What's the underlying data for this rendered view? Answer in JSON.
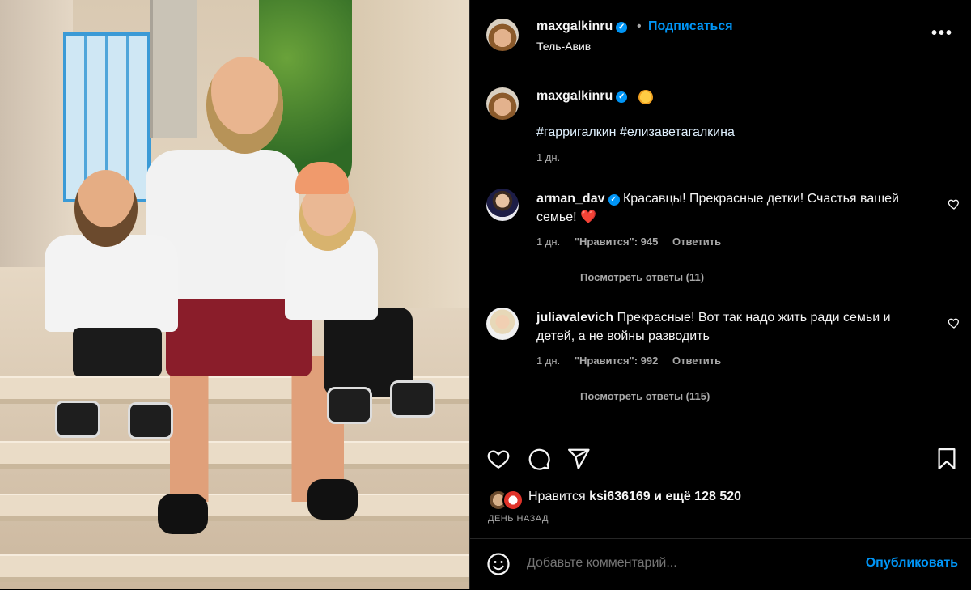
{
  "post": {
    "author": "maxgalkinru",
    "follow_label": "Подписаться",
    "location": "Тель-Авив",
    "more_label": "•••",
    "verified_mark": "✓"
  },
  "caption": {
    "author": "maxgalkinru",
    "hashtags": "#гарригалкин #елизаветагалкина",
    "time": "1 дн."
  },
  "comments": [
    {
      "author": "arman_dav",
      "verified": true,
      "text_line1": "Красавцы! Прекрасные детки! Счастья вашей",
      "text_line2": "семье! ❤️",
      "time": "1 дн.",
      "likes": "\"Нравится\": 945",
      "reply_label": "Ответить",
      "view_replies": "Посмотреть ответы (11)"
    },
    {
      "author": "juliavalevich",
      "verified": false,
      "text_line1": "Прекрасные! Вот так надо жить ради семьи и",
      "text_line2": "детей, а не войны разводить",
      "time": "1 дн.",
      "likes": "\"Нравится\": 992",
      "reply_label": "Ответить",
      "view_replies": "Посмотреть ответы (115)"
    }
  ],
  "likes_summary": {
    "prefix": "Нравится",
    "user": "ksi636169",
    "suffix": "и ещё 128 520"
  },
  "posted_ago": "ДЕНЬ НАЗАД",
  "comment_box": {
    "placeholder": "Добавьте комментарий...",
    "publish_label": "Опубликовать"
  },
  "icons": {
    "like": "heart-icon",
    "comment": "comment-icon",
    "share": "share-icon",
    "save": "bookmark-icon",
    "emoji": "emoji-icon"
  },
  "colors": {
    "background": "#000000",
    "link_blue": "#0095f6",
    "text": "#f5f5f5",
    "muted": "#a8a8a8",
    "divider": "#262626"
  }
}
